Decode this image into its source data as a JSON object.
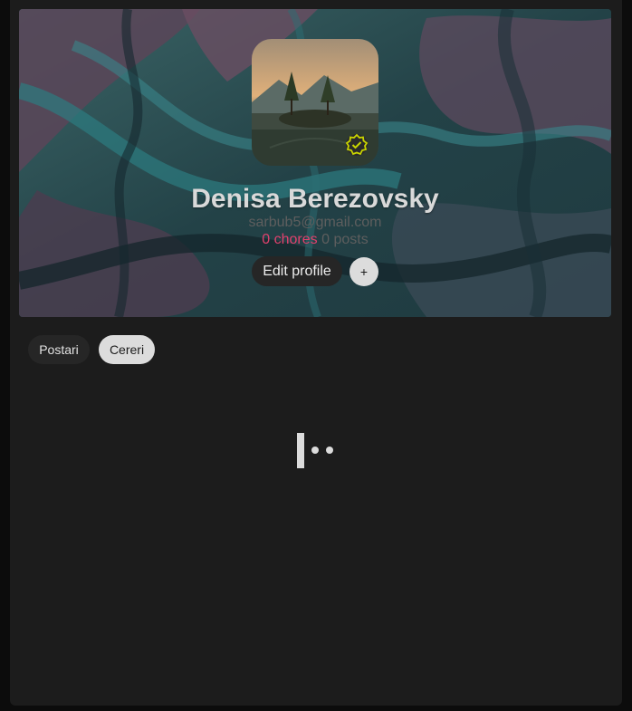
{
  "profile": {
    "name": "Denisa Berezovsky",
    "email": "sarbub5@gmail.com",
    "chores": "0 chores",
    "posts": "0 posts",
    "verified_icon": "verified-badge-icon",
    "avatar_image": "landscape-trees-photo"
  },
  "actions": {
    "edit_profile": "Edit profile",
    "add": "+"
  },
  "tabs": [
    {
      "label": "Postari",
      "active": false
    },
    {
      "label": "Cereri",
      "active": true
    }
  ],
  "colors": {
    "accent": "#e0416d",
    "verified": "#c8d400",
    "panel": "#1c1c1c"
  }
}
